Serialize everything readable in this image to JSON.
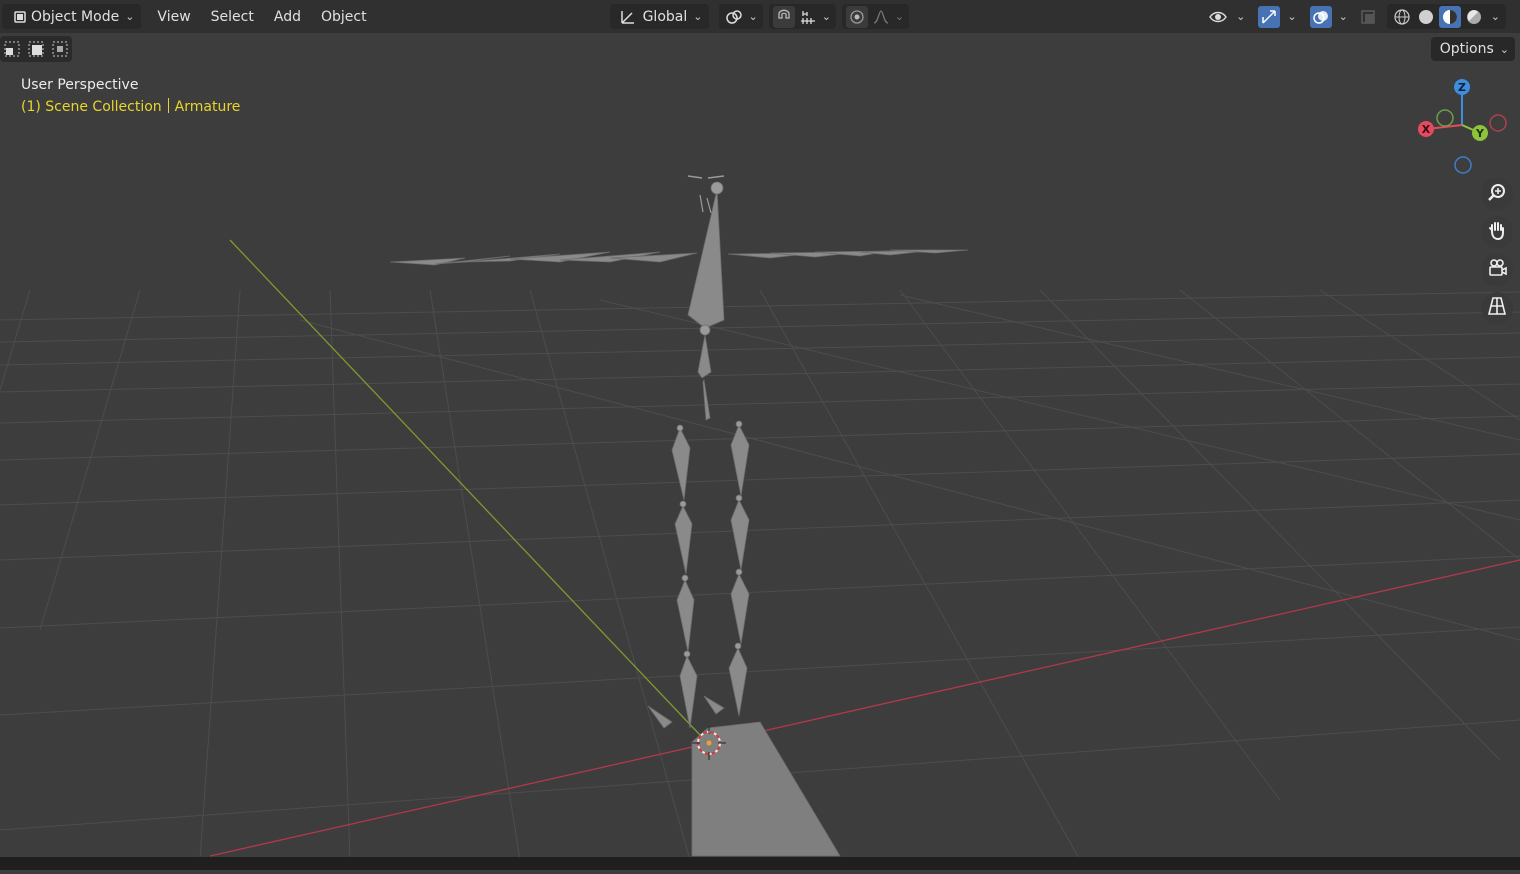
{
  "header": {
    "mode_label": "Object Mode",
    "menus": [
      "View",
      "Select",
      "Add",
      "Object"
    ],
    "transform_orientation": "Global",
    "options_label": "Options"
  },
  "viewport": {
    "view_name": "User Perspective",
    "collection_label": "(1) Scene Collection",
    "active_object": "Armature"
  },
  "gizmo": {
    "axes": {
      "z": "Z",
      "x": "X",
      "y": "Y"
    },
    "colors": {
      "x": "#e64a5f",
      "y": "#8cc43a",
      "z": "#3d8ee0"
    }
  },
  "icons": {
    "mode": "object-mode-icon",
    "orientation": "transform-orientation-icon",
    "pivot": "pivot-point-icon",
    "snap": "snap-magnet-icon",
    "snap_target": "snap-increment-icon",
    "proportional": "proportional-edit-icon",
    "falloff": "falloff-curve-icon",
    "visibility": "selectability-eye-icon",
    "gizmos": "gizmo-toggle-icon",
    "overlays": "overlays-toggle-icon",
    "xray": "xray-toggle-icon",
    "shading": [
      "wireframe-shading-icon",
      "solid-shading-icon",
      "material-preview-icon",
      "rendered-shading-icon"
    ],
    "nav": [
      "zoom-icon",
      "pan-hand-icon",
      "camera-view-icon",
      "ortho-grid-icon"
    ]
  },
  "colors": {
    "accent_blue": "#4772b3",
    "header_bg": "#303030",
    "viewport_bg": "#3d3d3d",
    "text_yellow": "#e7d42d",
    "x_axis_line": "#b0394a",
    "y_axis_line": "#7f9a2e",
    "bone_fill": "#8a8a8a"
  }
}
